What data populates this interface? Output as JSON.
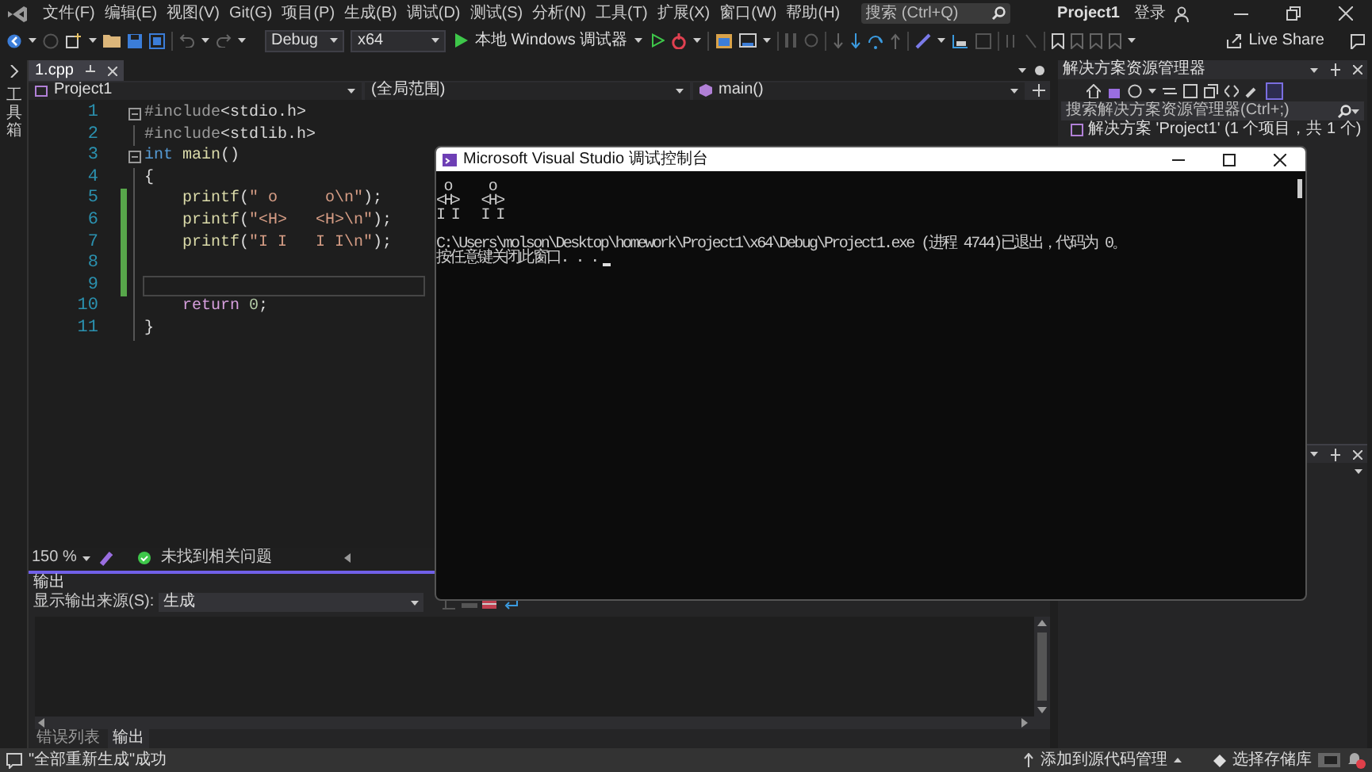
{
  "title_bar": {
    "menu": [
      "文件(F)",
      "编辑(E)",
      "视图(V)",
      "Git(G)",
      "项目(P)",
      "生成(B)",
      "调试(D)",
      "测试(S)",
      "分析(N)",
      "工具(T)",
      "扩展(X)",
      "窗口(W)",
      "帮助(H)"
    ],
    "search": {
      "placeholder": "搜索 (Ctrl+Q)"
    },
    "title": "Project1",
    "sign_in": "登录"
  },
  "toolbar": {
    "configuration": "Debug",
    "platform": "x64",
    "run_button": "本地 Windows 调试器",
    "live_share": "Live Share"
  },
  "toolbox_tab": "工具箱",
  "editor": {
    "tabs": [
      {
        "label": "1.cpp",
        "selected": true
      }
    ],
    "project_dropdown": "Project1",
    "scope_dropdown": "(全局范围)",
    "member_dropdown": "main()",
    "lines": [
      {
        "number": "1",
        "fold": true,
        "changed": false,
        "current": false,
        "segments": [
          {
            "text": "#include",
            "kind": "preprocessor"
          },
          {
            "text": "<stdio.h>",
            "kind": "header"
          }
        ]
      },
      {
        "number": "2",
        "fold": false,
        "changed": false,
        "current": false,
        "segments": [
          {
            "text": "#include",
            "kind": "preprocessor"
          },
          {
            "text": "<stdlib.h>",
            "kind": "header"
          }
        ]
      },
      {
        "number": "3",
        "fold": true,
        "changed": false,
        "current": false,
        "segments": [
          {
            "text": "int ",
            "kind": "keyword"
          },
          {
            "text": "main",
            "kind": "function"
          },
          {
            "text": "()",
            "kind": "plain"
          }
        ]
      },
      {
        "number": "4",
        "fold": false,
        "changed": false,
        "current": false,
        "segments": [
          {
            "text": "{",
            "kind": "plain"
          }
        ]
      },
      {
        "number": "5",
        "fold": false,
        "changed": true,
        "current": false,
        "segments": [
          {
            "text": "    printf",
            "kind": "function"
          },
          {
            "text": "(",
            "kind": "plain"
          },
          {
            "text": "\" o     o\\n\"",
            "kind": "string"
          },
          {
            "text": ");",
            "kind": "plain"
          }
        ]
      },
      {
        "number": "6",
        "fold": false,
        "changed": true,
        "current": false,
        "segments": [
          {
            "text": "    printf",
            "kind": "function"
          },
          {
            "text": "(",
            "kind": "plain"
          },
          {
            "text": "\"<H>   <H>\\n\"",
            "kind": "string"
          },
          {
            "text": ");",
            "kind": "plain"
          }
        ]
      },
      {
        "number": "7",
        "fold": false,
        "changed": true,
        "current": false,
        "segments": [
          {
            "text": "    printf",
            "kind": "function"
          },
          {
            "text": "(",
            "kind": "plain"
          },
          {
            "text": "\"I I   I I\\n\"",
            "kind": "string"
          },
          {
            "text": ");",
            "kind": "plain"
          }
        ]
      },
      {
        "number": "8",
        "fold": false,
        "changed": true,
        "current": false
      },
      {
        "number": "9",
        "fold": false,
        "changed": true,
        "current": true
      },
      {
        "number": "10",
        "fold": false,
        "changed": false,
        "current": false,
        "segments": [
          {
            "text": "    return ",
            "kind": "control"
          },
          {
            "text": "0",
            "kind": "number"
          },
          {
            "text": ";",
            "kind": "plain"
          }
        ]
      },
      {
        "number": "11",
        "fold": false,
        "changed": false,
        "current": false,
        "segments": [
          {
            "text": "}",
            "kind": "plain"
          }
        ]
      }
    ],
    "zoom": "150 %",
    "issues": "未找到相关问题"
  },
  "output": {
    "title": "输出",
    "source_label": "显示输出来源(S):",
    "source": "生成",
    "tabs": [
      {
        "label": "错误列表",
        "selected": false
      },
      {
        "label": "输出",
        "selected": true
      }
    ]
  },
  "solution_explorer": {
    "title": "解决方案资源管理器",
    "search": {
      "placeholder": "搜索解决方案资源管理器(Ctrl+;)"
    },
    "items": [
      {
        "label": "解决方案 'Project1' (1 个项目，共 1 个)"
      }
    ]
  },
  "console": {
    "title": "Microsoft Visual Studio 调试控制台",
    "program_output": [
      " o     o",
      "<H>   <H>",
      "I I   I I"
    ],
    "exit_message": "C:\\Users\\molson\\Desktop\\homework\\Project1\\x64\\Debug\\Project1.exe (进程 4744)已退出，代码为 0。",
    "prompt": "按任意键关闭此窗口. . ."
  },
  "status_bar": {
    "message": "\"全部重新生成\"成功",
    "source_control": "添加到源代码管理",
    "repository": "选择存储库"
  }
}
